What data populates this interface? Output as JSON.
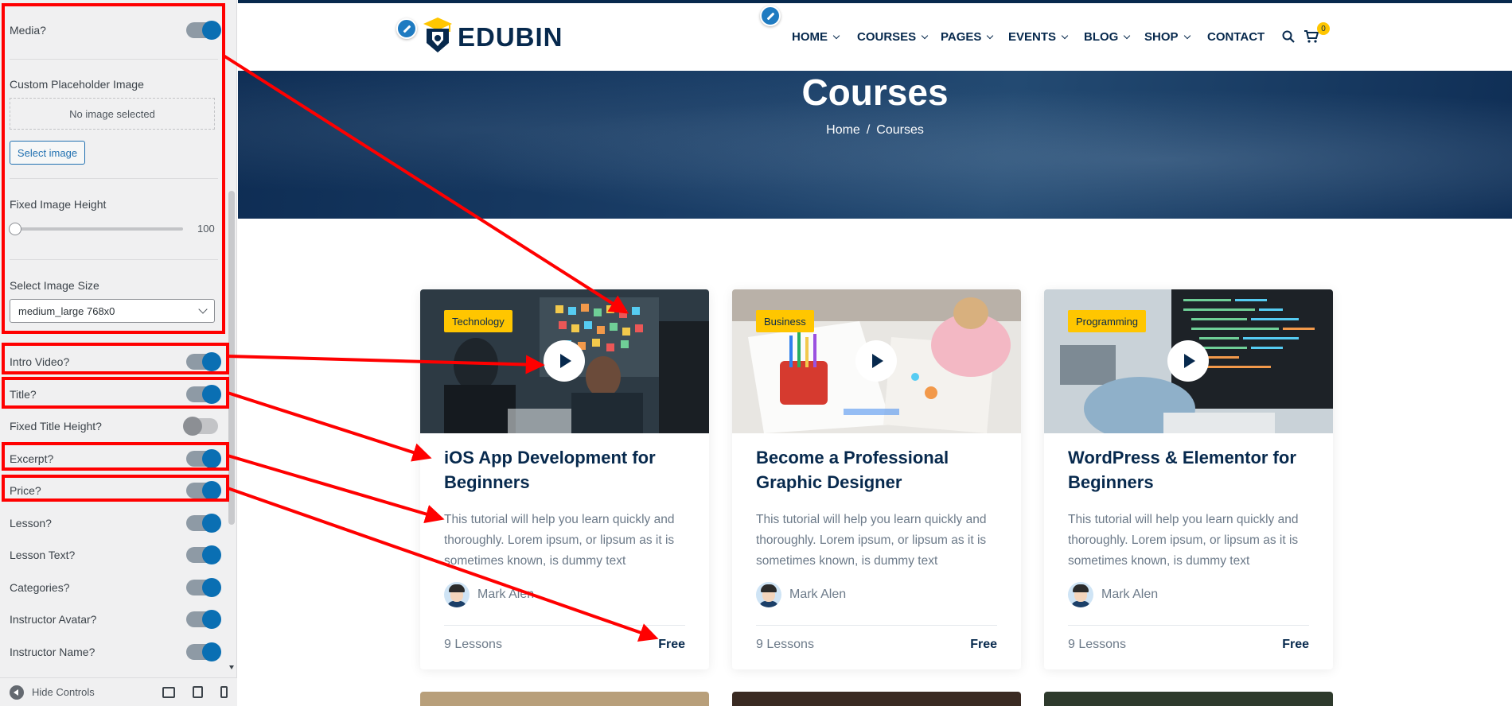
{
  "sidebar": {
    "media": {
      "label": "Media?",
      "on": true
    },
    "placeholder": {
      "label": "Custom Placeholder Image",
      "empty_text": "No image selected",
      "button": "Select image"
    },
    "fixed_image_height": {
      "label": "Fixed Image Height",
      "value": "100"
    },
    "image_size": {
      "label": "Select Image Size",
      "value": "medium_large 768x0"
    },
    "toggles": [
      {
        "label": "Intro Video?",
        "on": true
      },
      {
        "label": "Title?",
        "on": true
      },
      {
        "label": "Fixed Title Height?",
        "on": false
      },
      {
        "label": "Excerpt?",
        "on": true
      },
      {
        "label": "Price?",
        "on": true
      },
      {
        "label": "Lesson?",
        "on": true
      },
      {
        "label": "Lesson Text?",
        "on": true
      },
      {
        "label": "Categories?",
        "on": true
      },
      {
        "label": "Instructor Avatar?",
        "on": true
      },
      {
        "label": "Instructor Name?",
        "on": true
      }
    ],
    "footer": {
      "hide_controls": "Hide Controls"
    }
  },
  "site": {
    "logo": "EDUBIN",
    "nav": [
      {
        "label": "HOME",
        "dropdown": true
      },
      {
        "label": "COURSES",
        "dropdown": true
      },
      {
        "label": "PAGES",
        "dropdown": true
      },
      {
        "label": "EVENTS",
        "dropdown": true
      },
      {
        "label": "BLOG",
        "dropdown": true
      },
      {
        "label": "SHOP",
        "dropdown": true
      },
      {
        "label": "CONTACT",
        "dropdown": false
      }
    ],
    "cart_count": "0",
    "banner": {
      "title": "Courses",
      "breadcrumb": [
        "Home",
        "/",
        "Courses"
      ]
    },
    "courses": [
      {
        "category": "Technology",
        "title": "iOS App Development for Beginners",
        "excerpt": "This tutorial will help you learn quickly and thoroughly. Lorem ipsum, or lipsum as it is sometimes known, is dummy text",
        "instructor": "Mark Alen",
        "lessons": "9 Lessons",
        "price": "Free"
      },
      {
        "category": "Business",
        "title": "Become a Professional Graphic Designer",
        "excerpt": "This tutorial will help you learn quickly and thoroughly. Lorem ipsum, or lipsum as it is sometimes known, is dummy text",
        "instructor": "Mark Alen",
        "lessons": "9 Lessons",
        "price": "Free"
      },
      {
        "category": "Programming",
        "title": "WordPress & Elementor for Beginners",
        "excerpt": "This tutorial will help you learn quickly and thoroughly. Lorem ipsum, or lipsum as it is sometimes known, is dummy text",
        "instructor": "Mark Alen",
        "lessons": "9 Lessons",
        "price": "Free"
      }
    ]
  },
  "colors": {
    "navy": "#07294d",
    "accent_yellow": "#ffc600",
    "toggle_blue": "#0a6fb3",
    "annotation_red": "#ff0000"
  }
}
